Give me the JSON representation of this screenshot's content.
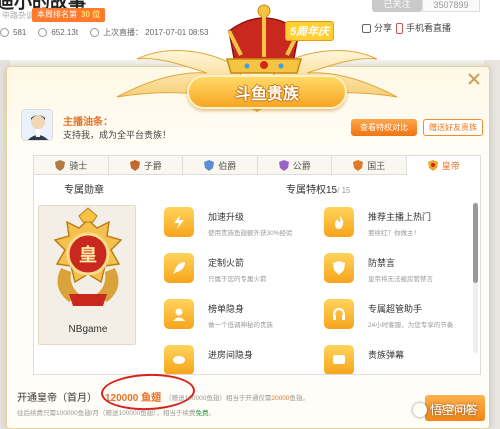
{
  "background_page": {
    "title": "迪小的故事",
    "category": "中路杂谈",
    "rank_label": "本周排名第",
    "rank_value": "30 位",
    "stats": {
      "viewers": "581",
      "heat": "652.13t",
      "last_live_label": "上次直播：",
      "last_live_time": "2017-07-01 08:53"
    },
    "follow_label": "已关注",
    "fans_count": "3507899",
    "share_label": "分享",
    "phone_label": "手机看直播"
  },
  "modal": {
    "logo_text": "斗鱼贵族",
    "event_badge": "5周年庆",
    "anchor": {
      "name_label": "主播油条：",
      "message": "支持我，成为全平台贵族！"
    },
    "buttons": {
      "view_privileges": "查看特权对比",
      "gift_friend": "赠送好友贵族",
      "open": "立即开通"
    },
    "tabs": [
      {
        "label": "骑士",
        "icon": "knight-badge-icon"
      },
      {
        "label": "子爵",
        "icon": "viscount-badge-icon"
      },
      {
        "label": "伯爵",
        "icon": "earl-badge-icon"
      },
      {
        "label": "公爵",
        "icon": "duke-badge-icon"
      },
      {
        "label": "国王",
        "icon": "king-badge-icon"
      },
      {
        "label": "皇帝",
        "icon": "emperor-badge-icon"
      }
    ],
    "active_tab": "皇帝",
    "medal_section_title": "专属勋章",
    "medal_name": "NBgame",
    "medal_emblem_char": "皇",
    "privileges_title": "专属特权15",
    "privileges_count": "/ 15",
    "perks": [
      {
        "name": "加速升级",
        "desc": "使用贵族鱼翅额外获30%经验",
        "icon": "lightning-icon"
      },
      {
        "name": "推荐主播上热门",
        "desc": "要续红？你做主！",
        "icon": "fire-icon"
      },
      {
        "name": "定制火箭",
        "desc": "只属于您的专属火箭",
        "icon": "rocket-icon"
      },
      {
        "name": "防禁言",
        "desc": "皇帝将无法被房管禁言",
        "icon": "shield-icon"
      },
      {
        "name": "榜单隐身",
        "desc": "做一个低调神秘的贵族",
        "icon": "stealth-icon"
      },
      {
        "name": "专属超管助手",
        "desc": "24小时客服，为您专享的节奏",
        "icon": "headset-icon"
      },
      {
        "name": "进房间隐身",
        "desc": "",
        "icon": "hidden-icon"
      },
      {
        "name": "贵族弹幕",
        "desc": "",
        "icon": "barrage-icon"
      }
    ],
    "footer": {
      "plan_label": "开通皇帝（首月）",
      "price": "120000 鱼翅",
      "gift_note_prefix": "（赠送100000鱼翅",
      "gift_note_suffix": "）相当于开通仅需",
      "gift_note_highlight": "20000",
      "gift_note_end": "鱼翅。",
      "renew_note_prefix": "往后续费只需100000鱼翅/月（赠送100000鱼翅），相当于续费",
      "renew_highlight": "免费",
      "renew_note_end": "。"
    },
    "watermark": "悟空问答"
  },
  "colors": {
    "accent_orange": "#f07412",
    "gold": "#f7a41a",
    "annotation_red": "#d8231c"
  }
}
